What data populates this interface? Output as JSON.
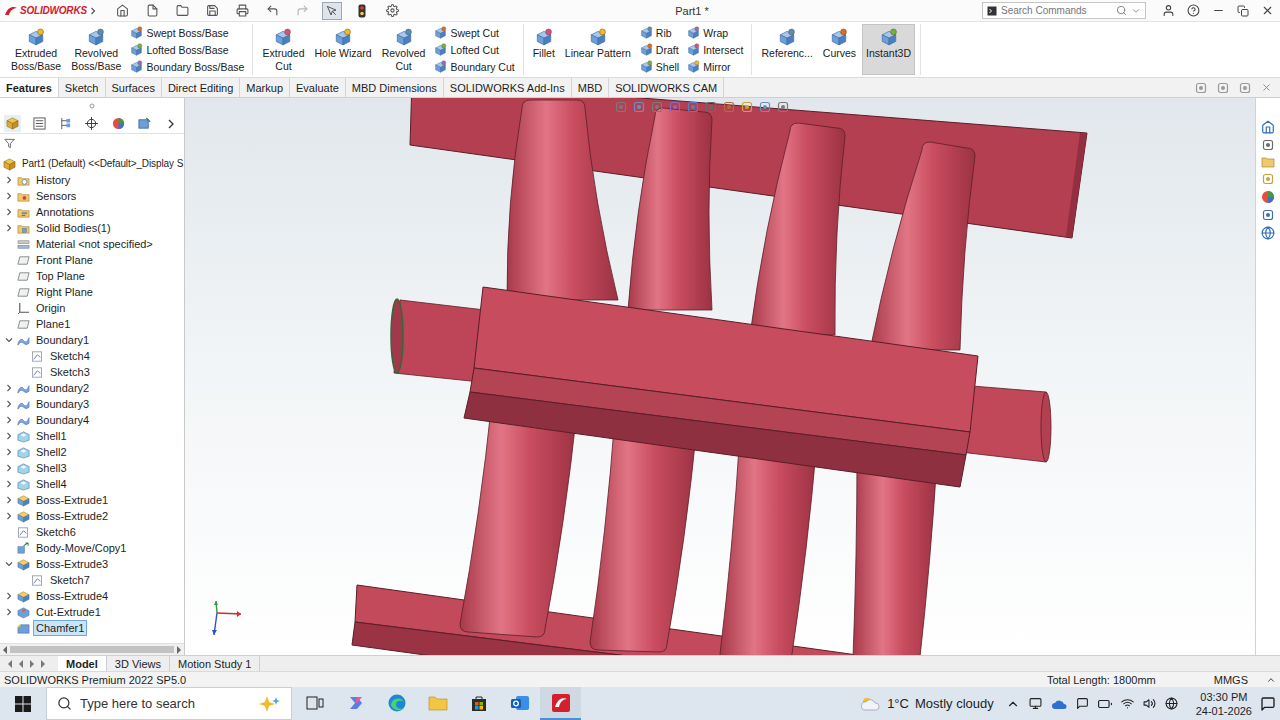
{
  "app": {
    "logo": "SOLIDWORKS",
    "document_title": "Part1 *",
    "search_placeholder": "Search Commands"
  },
  "ribbon": {
    "groups": [
      {
        "items": [
          {
            "kind": "large",
            "lines": [
              "Extruded",
              "Boss/Base"
            ],
            "selected": false
          },
          {
            "kind": "large",
            "lines": [
              "Revolved",
              "Boss/Base"
            ],
            "selected": false
          },
          {
            "kind": "column",
            "entries": [
              "Swept Boss/Base",
              "Lofted Boss/Base",
              "Boundary Boss/Base"
            ]
          }
        ]
      },
      {
        "items": [
          {
            "kind": "large",
            "lines": [
              "Extruded",
              "Cut"
            ],
            "selected": false
          },
          {
            "kind": "large",
            "lines": [
              "Hole Wizard"
            ],
            "selected": false
          },
          {
            "kind": "large",
            "lines": [
              "Revolved",
              "Cut"
            ],
            "selected": false
          },
          {
            "kind": "column",
            "entries": [
              "Swept Cut",
              "Lofted Cut",
              "Boundary Cut"
            ]
          }
        ]
      },
      {
        "items": [
          {
            "kind": "large",
            "lines": [
              "Fillet"
            ],
            "selected": false
          },
          {
            "kind": "large",
            "lines": [
              "Linear Pattern"
            ],
            "selected": false
          },
          {
            "kind": "column",
            "entries": [
              "Rib",
              "Draft",
              "Shell"
            ]
          },
          {
            "kind": "column",
            "entries": [
              "Wrap",
              "Intersect",
              "Mirror"
            ]
          }
        ]
      },
      {
        "items": [
          {
            "kind": "large",
            "lines": [
              "Referenc..."
            ],
            "selected": false
          },
          {
            "kind": "large",
            "lines": [
              "Curves"
            ],
            "selected": false
          },
          {
            "kind": "large",
            "lines": [
              "Instant3D"
            ],
            "selected": true
          }
        ]
      }
    ]
  },
  "command_tabs": [
    {
      "label": "Features",
      "selected": true
    },
    {
      "label": "Sketch",
      "selected": false
    },
    {
      "label": "Surfaces",
      "selected": false
    },
    {
      "label": "Direct Editing",
      "selected": false
    },
    {
      "label": "Markup",
      "selected": false
    },
    {
      "label": "Evaluate",
      "selected": false
    },
    {
      "label": "MBD Dimensions",
      "selected": false
    },
    {
      "label": "SOLIDWORKS Add-Ins",
      "selected": false
    },
    {
      "label": "MBD",
      "selected": false
    },
    {
      "label": "SOLIDWORKS CAM",
      "selected": false
    }
  ],
  "feature_tree": {
    "root": {
      "label": "Part1 (Default) <<Default>_Display S",
      "kind": "part",
      "selected": false
    },
    "items": [
      {
        "label": "History",
        "kind": "history",
        "expandable": true,
        "expanded": false,
        "selected": false
      },
      {
        "label": "Sensors",
        "kind": "sensor",
        "expandable": true,
        "expanded": false,
        "selected": false
      },
      {
        "label": "Annotations",
        "kind": "annotation",
        "expandable": true,
        "expanded": false,
        "selected": false
      },
      {
        "label": "Solid Bodies(1)",
        "kind": "bodies",
        "expandable": true,
        "expanded": false,
        "selected": false
      },
      {
        "label": "Material <not specified>",
        "kind": "material",
        "expandable": false,
        "expanded": false,
        "selected": false
      },
      {
        "label": "Front Plane",
        "kind": "plane",
        "expandable": false,
        "expanded": false,
        "selected": false
      },
      {
        "label": "Top Plane",
        "kind": "plane",
        "expandable": false,
        "expanded": false,
        "selected": false
      },
      {
        "label": "Right Plane",
        "kind": "plane",
        "expandable": false,
        "expanded": false,
        "selected": false
      },
      {
        "label": "Origin",
        "kind": "origin",
        "expandable": false,
        "expanded": false,
        "selected": false
      },
      {
        "label": "Plane1",
        "kind": "plane",
        "expandable": false,
        "expanded": false,
        "selected": false
      },
      {
        "label": "Boundary1",
        "kind": "boundary",
        "expandable": true,
        "expanded": true,
        "selected": false,
        "children": [
          {
            "label": "Sketch4",
            "kind": "sketch",
            "expandable": false,
            "expanded": false,
            "selected": false
          },
          {
            "label": "Sketch3",
            "kind": "sketch",
            "expandable": false,
            "expanded": false,
            "selected": false
          }
        ]
      },
      {
        "label": "Boundary2",
        "kind": "boundary",
        "expandable": true,
        "expanded": false,
        "selected": false
      },
      {
        "label": "Boundary3",
        "kind": "boundary",
        "expandable": true,
        "expanded": false,
        "selected": false
      },
      {
        "label": "Boundary4",
        "kind": "boundary",
        "expandable": true,
        "expanded": false,
        "selected": false
      },
      {
        "label": "Shell1",
        "kind": "shell",
        "expandable": true,
        "expanded": false,
        "selected": false
      },
      {
        "label": "Shell2",
        "kind": "shell",
        "expandable": true,
        "expanded": false,
        "selected": false
      },
      {
        "label": "Shell3",
        "kind": "shell",
        "expandable": true,
        "expanded": false,
        "selected": false
      },
      {
        "label": "Shell4",
        "kind": "shell",
        "expandable": true,
        "expanded": false,
        "selected": false
      },
      {
        "label": "Boss-Extrude1",
        "kind": "extrude",
        "expandable": true,
        "expanded": false,
        "selected": false
      },
      {
        "label": "Boss-Extrude2",
        "kind": "extrude",
        "expandable": true,
        "expanded": false,
        "selected": false
      },
      {
        "label": "Sketch6",
        "kind": "sketch",
        "expandable": false,
        "expanded": false,
        "selected": false
      },
      {
        "label": "Body-Move/Copy1",
        "kind": "move",
        "expandable": false,
        "expanded": false,
        "selected": false
      },
      {
        "label": "Boss-Extrude3",
        "kind": "extrude",
        "expandable": true,
        "expanded": true,
        "selected": false,
        "children": [
          {
            "label": "Sketch7",
            "kind": "sketch",
            "expandable": false,
            "expanded": false,
            "selected": false
          }
        ]
      },
      {
        "label": "Boss-Extrude4",
        "kind": "extrude",
        "expandable": true,
        "expanded": false,
        "selected": false
      },
      {
        "label": "Cut-Extrude1",
        "kind": "cut",
        "expandable": true,
        "expanded": false,
        "selected": false
      },
      {
        "label": "Chamfer1",
        "kind": "chamfer",
        "expandable": false,
        "expanded": false,
        "selected": true
      }
    ]
  },
  "view_tabs": [
    {
      "label": "Model",
      "selected": true
    },
    {
      "label": "3D Views",
      "selected": false
    },
    {
      "label": "Motion Study 1",
      "selected": false
    }
  ],
  "status_bar": {
    "product": "SOLIDWORKS Premium 2022 SP5.0",
    "total_length": "Total Length: 1800mm",
    "units": "MMGS"
  },
  "taskbar": {
    "search_placeholder": "Type here to search",
    "temperature": "1°C",
    "weather": "Mostly cloudy",
    "time": "03:30 PM",
    "date": "24-01-2026"
  }
}
